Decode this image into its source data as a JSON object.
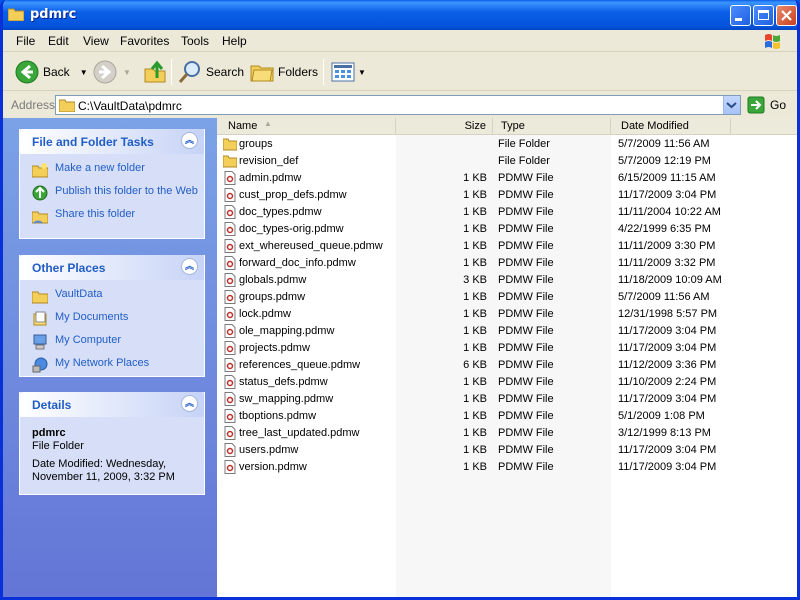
{
  "window": {
    "title": "pdmrc"
  },
  "menu": [
    {
      "label": "File"
    },
    {
      "label": "Edit"
    },
    {
      "label": "View"
    },
    {
      "label": "Favorites"
    },
    {
      "label": "Tools"
    },
    {
      "label": "Help"
    }
  ],
  "toolbar": {
    "back": "Back",
    "search": "Search",
    "folders": "Folders"
  },
  "address": {
    "label": "Address",
    "path": "C:\\VaultData\\pdmrc",
    "go": "Go"
  },
  "tasks_panel": {
    "title": "File and Folder Tasks",
    "items": [
      {
        "label": "Make a new folder",
        "icon": "new-folder-icon"
      },
      {
        "label": "Publish this folder to the Web",
        "icon": "publish-web-icon"
      },
      {
        "label": "Share this folder",
        "icon": "share-folder-icon"
      }
    ]
  },
  "places_panel": {
    "title": "Other Places",
    "items": [
      {
        "label": "VaultData",
        "icon": "folder-icon"
      },
      {
        "label": "My Documents",
        "icon": "my-documents-icon"
      },
      {
        "label": "My Computer",
        "icon": "my-computer-icon"
      },
      {
        "label": "My Network Places",
        "icon": "network-places-icon"
      }
    ]
  },
  "details_panel": {
    "title": "Details",
    "name": "pdmrc",
    "type": "File Folder",
    "modified": "Date Modified: Wednesday, November 11, 2009, 3:32 PM"
  },
  "columns": {
    "name": "Name",
    "size": "Size",
    "type": "Type",
    "date": "Date Modified"
  },
  "files": [
    {
      "name": "groups",
      "size": "",
      "type": "File Folder",
      "date": "5/7/2009 11:56 AM",
      "kind": "folder"
    },
    {
      "name": "revision_def",
      "size": "",
      "type": "File Folder",
      "date": "5/7/2009 12:19 PM",
      "kind": "folder"
    },
    {
      "name": "admin.pdmw",
      "size": "1 KB",
      "type": "PDMW File",
      "date": "6/15/2009 11:15 AM",
      "kind": "file"
    },
    {
      "name": "cust_prop_defs.pdmw",
      "size": "1 KB",
      "type": "PDMW File",
      "date": "11/17/2009 3:04 PM",
      "kind": "file"
    },
    {
      "name": "doc_types.pdmw",
      "size": "1 KB",
      "type": "PDMW File",
      "date": "11/11/2004 10:22 AM",
      "kind": "file"
    },
    {
      "name": "doc_types-orig.pdmw",
      "size": "1 KB",
      "type": "PDMW File",
      "date": "4/22/1999 6:35 PM",
      "kind": "file"
    },
    {
      "name": "ext_whereused_queue.pdmw",
      "size": "1 KB",
      "type": "PDMW File",
      "date": "11/11/2009 3:30 PM",
      "kind": "file"
    },
    {
      "name": "forward_doc_info.pdmw",
      "size": "1 KB",
      "type": "PDMW File",
      "date": "11/11/2009 3:32 PM",
      "kind": "file"
    },
    {
      "name": "globals.pdmw",
      "size": "3 KB",
      "type": "PDMW File",
      "date": "11/18/2009 10:09 AM",
      "kind": "file"
    },
    {
      "name": "groups.pdmw",
      "size": "1 KB",
      "type": "PDMW File",
      "date": "5/7/2009 11:56 AM",
      "kind": "file"
    },
    {
      "name": "lock.pdmw",
      "size": "1 KB",
      "type": "PDMW File",
      "date": "12/31/1998 5:57 PM",
      "kind": "file"
    },
    {
      "name": "ole_mapping.pdmw",
      "size": "1 KB",
      "type": "PDMW File",
      "date": "11/17/2009 3:04 PM",
      "kind": "file"
    },
    {
      "name": "projects.pdmw",
      "size": "1 KB",
      "type": "PDMW File",
      "date": "11/17/2009 3:04 PM",
      "kind": "file"
    },
    {
      "name": "references_queue.pdmw",
      "size": "6 KB",
      "type": "PDMW File",
      "date": "11/12/2009 3:36 PM",
      "kind": "file"
    },
    {
      "name": "status_defs.pdmw",
      "size": "1 KB",
      "type": "PDMW File",
      "date": "11/10/2009 2:24 PM",
      "kind": "file"
    },
    {
      "name": "sw_mapping.pdmw",
      "size": "1 KB",
      "type": "PDMW File",
      "date": "11/17/2009 3:04 PM",
      "kind": "file"
    },
    {
      "name": "tboptions.pdmw",
      "size": "1 KB",
      "type": "PDMW File",
      "date": "5/1/2009 1:08 PM",
      "kind": "file"
    },
    {
      "name": "tree_last_updated.pdmw",
      "size": "1 KB",
      "type": "PDMW File",
      "date": "3/12/1999 8:13 PM",
      "kind": "file"
    },
    {
      "name": "users.pdmw",
      "size": "1 KB",
      "type": "PDMW File",
      "date": "11/17/2009 3:04 PM",
      "kind": "file"
    },
    {
      "name": "version.pdmw",
      "size": "1 KB",
      "type": "PDMW File",
      "date": "11/17/2009 3:04 PM",
      "kind": "file"
    }
  ],
  "colors": {
    "title_blue": "#0a5fe6",
    "task_link": "#215dc6",
    "folder_yellow": "#f3cf5a",
    "pane_blue": "#7ba2e7"
  }
}
